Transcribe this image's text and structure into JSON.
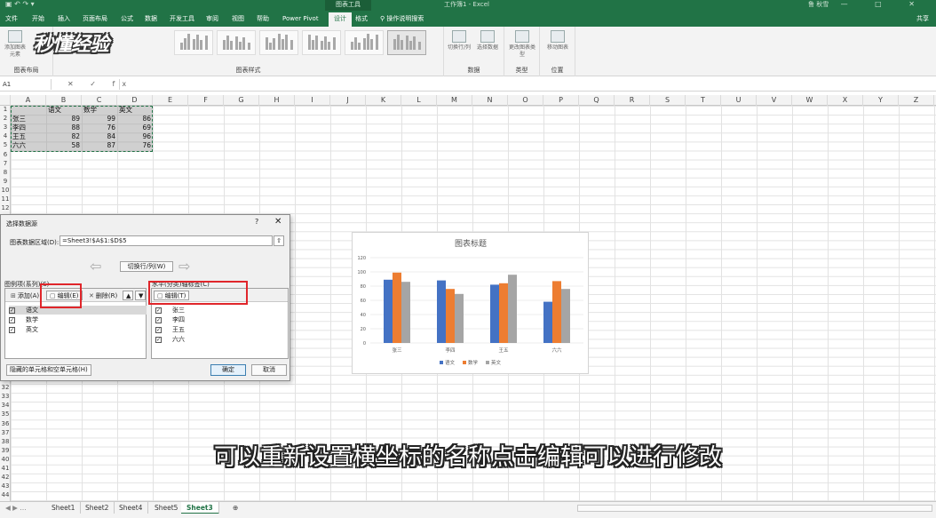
{
  "titlebar": {
    "context_tab": "图表工具",
    "document": "工作簿1 - Excel",
    "user": "鲁 秋雪",
    "window_buttons": "— □ ✕"
  },
  "ribbon_tabs": [
    "文件",
    "开始",
    "插入",
    "页面布局",
    "公式",
    "数据",
    "开发工具",
    "审阅",
    "视图",
    "帮助",
    "Power Pivot",
    "设计",
    "格式",
    "操作说明搜索"
  ],
  "active_tab": "设计",
  "share": "共享",
  "ribbon": {
    "groups": {
      "chart_layout": "图表布局",
      "chart_styles": "图表样式",
      "data": "数据",
      "type": "类型",
      "location": "位置"
    },
    "buttons": {
      "add_element": "添加图表元素",
      "switch_row_col": "切换行/列",
      "select_data": "选择数据",
      "change_type": "更改图表类型",
      "move_chart": "移动图表"
    }
  },
  "watermark": "秒懂经验",
  "formula_bar": {
    "name_box": "A1",
    "fx": "fx",
    "value": ""
  },
  "columns": [
    "A",
    "B",
    "C",
    "D",
    "E",
    "F",
    "G",
    "H",
    "I",
    "J",
    "K",
    "L",
    "M",
    "N",
    "O",
    "P",
    "Q",
    "R",
    "S",
    "T",
    "U",
    "V",
    "W",
    "X",
    "Y",
    "Z"
  ],
  "sheet": {
    "headers": [
      "",
      "语文",
      "数学",
      "英文"
    ],
    "rows": [
      [
        "张三",
        "89",
        "99",
        "86"
      ],
      [
        "李四",
        "88",
        "76",
        "69"
      ],
      [
        "王五",
        "82",
        "84",
        "96"
      ],
      [
        "六六",
        "58",
        "87",
        "76"
      ]
    ]
  },
  "sheet_tabs": [
    "Sheet1",
    "Sheet2",
    "Sheet4",
    "Sheet5",
    "Sheet3"
  ],
  "active_sheet": "Sheet3",
  "dialog": {
    "title": "选择数据源",
    "help": "?",
    "close": "✕",
    "range_label": "图表数据区域(D):",
    "range_value": "=Sheet3!$A$1:$D$5",
    "switch_label": "切换行/列(W)",
    "legend_pane_label": "图例项(系列)(S)",
    "axis_pane_label": "水平(分类)轴标签(C)",
    "add_label": "添加(A)",
    "edit_label": "编辑(E)",
    "delete_label": "删除(R)",
    "axis_edit_label": "编辑(T)",
    "series": [
      "语文",
      "数学",
      "英文"
    ],
    "categories": [
      "张三",
      "李四",
      "王五",
      "六六"
    ],
    "hidden_cells_label": "隐藏的单元格和空单元格(H)",
    "ok_label": "确定",
    "cancel_label": "取消"
  },
  "chart_data": {
    "type": "bar",
    "title": "图表标题",
    "categories": [
      "张三",
      "李四",
      "王五",
      "六六"
    ],
    "series": [
      {
        "name": "语文",
        "values": [
          89,
          88,
          82,
          58
        ],
        "color": "#4472c4"
      },
      {
        "name": "数学",
        "values": [
          99,
          76,
          84,
          87
        ],
        "color": "#ed7d31"
      },
      {
        "name": "英文",
        "values": [
          86,
          69,
          96,
          76
        ],
        "color": "#a5a5a5"
      }
    ],
    "ylim": [
      0,
      120
    ],
    "yticks": [
      0,
      20,
      40,
      60,
      80,
      100,
      120
    ],
    "grid": true,
    "legend": "bottom"
  },
  "subtitle": "可以重新设置横坐标的名称点击编辑可以进行修改"
}
